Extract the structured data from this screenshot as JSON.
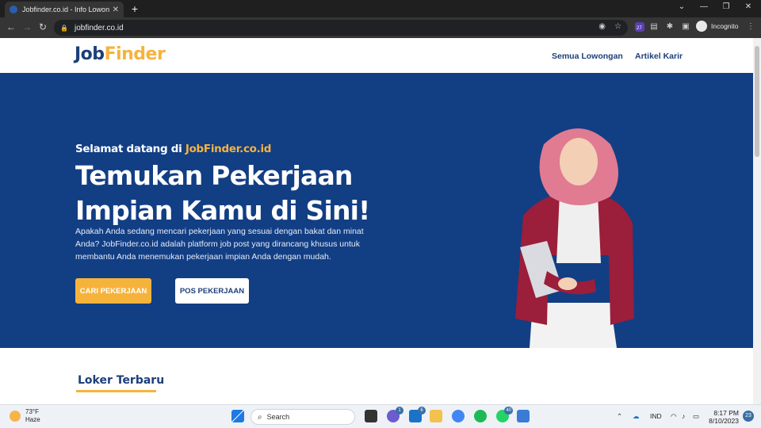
{
  "browser": {
    "tab_title": "Jobfinder.co.id - Info Lowongan K",
    "tab_close": "✕",
    "new_tab": "+",
    "url": "jobfinder.co.id",
    "incognito_label": "Incognito",
    "extension_badge": "27"
  },
  "site": {
    "logo_part1": "Job",
    "logo_part2": "Finder",
    "nav": [
      "Semua Lowongan",
      "Artikel Karir"
    ]
  },
  "hero": {
    "welcome_prefix": "Selamat datang di ",
    "welcome_brand": "JobFinder.co.id",
    "headline_line1": "Temukan Pekerjaan",
    "headline_line2": "Impian Kamu di Sini!",
    "description": "Apakah Anda sedang mencari pekerjaan yang sesuai dengan bakat dan minat Anda? JobFinder.co.id adalah platform job post yang dirancang khusus untuk membantu Anda menemukan pekerjaan impian Anda dengan mudah.",
    "primary_button": "CARI PEKERJAAN",
    "secondary_button": "POS PEKERJAAN"
  },
  "section": {
    "title": "Loker Terbaru"
  },
  "taskbar": {
    "temperature": "73°F",
    "weather": "Haze",
    "search_placeholder": "Search",
    "language": "IND",
    "time": "8:17 PM",
    "date": "8/10/2023",
    "badges": {
      "teams": "1",
      "mail": "6",
      "whatsapp": "40",
      "notifications": "23"
    }
  },
  "colors": {
    "navy": "#123e84",
    "brand_blue": "#1d3f7a",
    "accent_yellow": "#f6b33c"
  }
}
